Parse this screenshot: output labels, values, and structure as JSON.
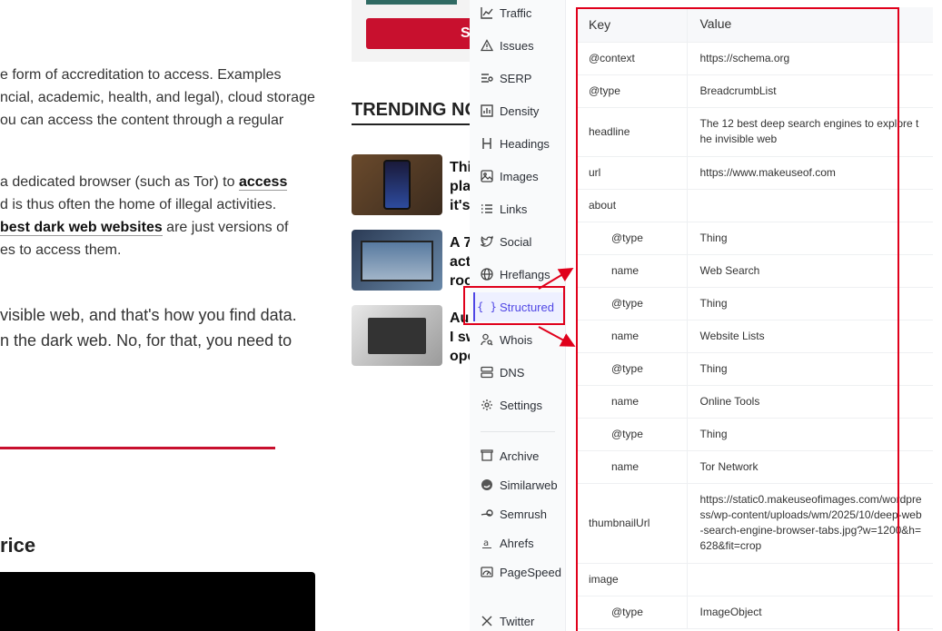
{
  "article": {
    "p1": [
      "e form of accreditation to access. Examples",
      "ncial, academic, health, and legal), cloud storage",
      "ou can access the content through a regular"
    ],
    "p2": {
      "l1_pre": "a dedicated browser (such as Tor) to ",
      "l1_link": "access",
      "l2": "d is thus often the home of illegal activities.",
      "l3_link": "best dark web websites",
      "l3_post": " are just versions of",
      "l4": "es to access them."
    },
    "p3": [
      "visible web, and that's how you find data.",
      "n the dark web. No, for that, you need to"
    ],
    "price_heading": "rice"
  },
  "middle": {
    "top_button_label": "S",
    "trending_heading": "TRENDING NO",
    "items": [
      {
        "lines": [
          "Thi",
          "pla",
          "it's"
        ]
      },
      {
        "lines": [
          "A 7",
          "act",
          "roo"
        ]
      },
      {
        "lines": [
          "Au",
          "I sw",
          "ope"
        ]
      }
    ]
  },
  "nav": {
    "items": [
      {
        "label": "Traffic",
        "icon": "traffic-chart-icon"
      },
      {
        "label": "Issues",
        "icon": "warning-triangle-icon"
      },
      {
        "label": "SERP",
        "icon": "serp-list-icon"
      },
      {
        "label": "Density",
        "icon": "density-chart-icon"
      },
      {
        "label": "Headings",
        "icon": "heading-h-icon"
      },
      {
        "label": "Images",
        "icon": "image-icon"
      },
      {
        "label": "Links",
        "icon": "link-list-icon"
      },
      {
        "label": "Social",
        "icon": "twitter-bird-icon"
      },
      {
        "label": "Hreflangs",
        "icon": "globe-icon"
      },
      {
        "label": "Structured",
        "icon": "braces-icon",
        "icon_text": "{ }"
      },
      {
        "label": "Whois",
        "icon": "user-search-icon"
      },
      {
        "label": "DNS",
        "icon": "server-icon"
      },
      {
        "label": "Settings",
        "icon": "gear-icon"
      }
    ],
    "tools": [
      {
        "label": "Archive",
        "icon": "archive-icon"
      },
      {
        "label": "Similarweb",
        "icon": "similarweb-icon"
      },
      {
        "label": "Semrush",
        "icon": "semrush-icon"
      },
      {
        "label": "Ahrefs",
        "icon": "ahrefs-icon"
      },
      {
        "label": "PageSpeed",
        "icon": "pagespeed-icon"
      },
      {
        "label": "Twitter",
        "icon": "x-logo-icon"
      }
    ],
    "active": "Structured"
  },
  "table": {
    "headers": {
      "key": "Key",
      "value": "Value"
    },
    "rows": [
      {
        "key": "@context",
        "value": "https://schema.org"
      },
      {
        "key": "@type",
        "value": "BreadcrumbList"
      },
      {
        "key": "headline",
        "value": "The 12 best deep search engines to explore the invisible web"
      },
      {
        "key": "url",
        "value": "https://www.makeuseof.com"
      },
      {
        "key": "about",
        "value": ""
      },
      {
        "key": "@type",
        "value": "Thing"
      },
      {
        "key": "name",
        "value": "Web Search"
      },
      {
        "key": "@type",
        "value": "Thing"
      },
      {
        "key": "name",
        "value": "Website Lists"
      },
      {
        "key": "@type",
        "value": "Thing"
      },
      {
        "key": "name",
        "value": "Online Tools"
      },
      {
        "key": "@type",
        "value": "Thing"
      },
      {
        "key": "name",
        "value": "Tor Network"
      },
      {
        "key": "thumbnailUrl",
        "value": "https://static0.makeuseofimages.com/wordpress/wp-content/uploads/wm/2025/10/deep-web-search-engine-browser-tabs.jpg?w=1200&h=628&fit=crop"
      },
      {
        "key": "image",
        "value": ""
      },
      {
        "key": "@type",
        "value": "ImageObject"
      }
    ]
  },
  "colors": {
    "annotation_red": "#e0001b",
    "accent_indigo": "#4f46e5",
    "site_red": "#c8102e"
  }
}
